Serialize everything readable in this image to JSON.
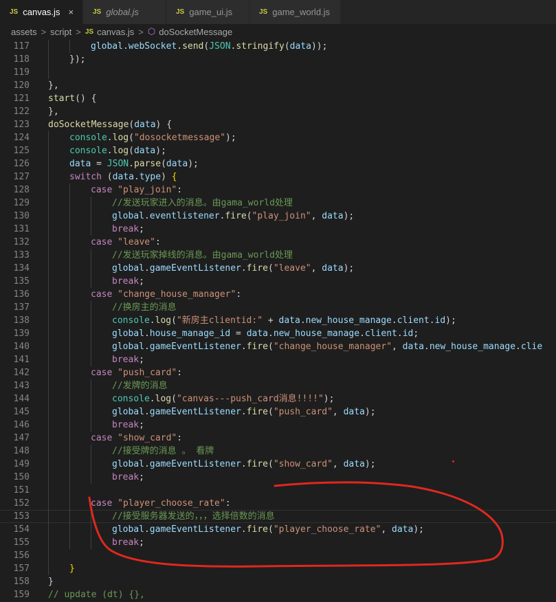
{
  "tabs": [
    {
      "label": "canvas.js",
      "icon": "JS",
      "active": true,
      "italic": false,
      "close": "×"
    },
    {
      "label": "global.js",
      "icon": "JS",
      "active": false,
      "italic": true
    },
    {
      "label": "game_ui.js",
      "icon": "JS",
      "active": false,
      "italic": false
    },
    {
      "label": "game_world.js",
      "icon": "JS",
      "active": false,
      "italic": false
    }
  ],
  "breadcrumb": {
    "items": [
      "assets",
      "script",
      "canvas.js",
      "doSocketMessage"
    ],
    "separator": ">",
    "file_icon": "JS",
    "symbol_icon": "cube-icon"
  },
  "colors": {
    "keyword": "#c586c0",
    "string": "#ce9178",
    "function": "#dcdcaa",
    "variable": "#9cdcfe",
    "class": "#4ec9b0",
    "comment": "#6a9955",
    "annotation": "#e0281e"
  },
  "code": {
    "current_line": 153,
    "lines": [
      {
        "n": "117",
        "indent": 2,
        "tokens": [
          [
            "vr",
            "global"
          ],
          [
            "pl",
            "."
          ],
          [
            "vr",
            "webSocket"
          ],
          [
            "pl",
            "."
          ],
          [
            "fn",
            "send"
          ],
          [
            "pl",
            "("
          ],
          [
            "cl",
            "JSON"
          ],
          [
            "pl",
            "."
          ],
          [
            "fn",
            "stringify"
          ],
          [
            "pl",
            "("
          ],
          [
            "vr",
            "data"
          ],
          [
            "pl",
            "));"
          ]
        ]
      },
      {
        "n": "118",
        "indent": 1,
        "tokens": [
          [
            "pl",
            "});"
          ]
        ]
      },
      {
        "n": "119",
        "indent": 0,
        "tokens": []
      },
      {
        "n": "120",
        "indent": 0,
        "tokens": [
          [
            "pl",
            "},"
          ]
        ]
      },
      {
        "n": "121",
        "indent": 0,
        "tokens": [
          [
            "fn",
            "start"
          ],
          [
            "pl",
            "() {"
          ]
        ]
      },
      {
        "n": "122",
        "indent": 0,
        "tokens": [
          [
            "pl",
            "},"
          ]
        ]
      },
      {
        "n": "123",
        "indent": 0,
        "tokens": [
          [
            "fn",
            "doSocketMessage"
          ],
          [
            "pl",
            "("
          ],
          [
            "vr",
            "data"
          ],
          [
            "pl",
            ") {"
          ]
        ]
      },
      {
        "n": "124",
        "indent": 1,
        "tokens": [
          [
            "cl",
            "console"
          ],
          [
            "pl",
            "."
          ],
          [
            "fn",
            "log"
          ],
          [
            "pl",
            "("
          ],
          [
            "st",
            "\"dosocketmessage\""
          ],
          [
            "pl",
            ");"
          ]
        ]
      },
      {
        "n": "125",
        "indent": 1,
        "tokens": [
          [
            "cl",
            "console"
          ],
          [
            "pl",
            "."
          ],
          [
            "fn",
            "log"
          ],
          [
            "pl",
            "("
          ],
          [
            "vr",
            "data"
          ],
          [
            "pl",
            ");"
          ]
        ]
      },
      {
        "n": "126",
        "indent": 1,
        "tokens": [
          [
            "vr",
            "data"
          ],
          [
            "pl",
            " = "
          ],
          [
            "cl",
            "JSON"
          ],
          [
            "pl",
            "."
          ],
          [
            "fn",
            "parse"
          ],
          [
            "pl",
            "("
          ],
          [
            "vr",
            "data"
          ],
          [
            "pl",
            ");"
          ]
        ]
      },
      {
        "n": "127",
        "indent": 1,
        "tokens": [
          [
            "kw",
            "switch"
          ],
          [
            "pl",
            " ("
          ],
          [
            "vr",
            "data"
          ],
          [
            "pl",
            "."
          ],
          [
            "vr",
            "type"
          ],
          [
            "pl",
            ") "
          ],
          [
            "br",
            "{"
          ]
        ]
      },
      {
        "n": "128",
        "indent": 2,
        "tokens": [
          [
            "kw",
            "case"
          ],
          [
            "pl",
            " "
          ],
          [
            "st",
            "\"play_join\""
          ],
          [
            "pl",
            ":"
          ]
        ]
      },
      {
        "n": "129",
        "indent": 3,
        "tokens": [
          [
            "cm",
            "//发送玩家进入的消息。由gama_world处理"
          ]
        ]
      },
      {
        "n": "130",
        "indent": 3,
        "tokens": [
          [
            "vr",
            "global"
          ],
          [
            "pl",
            "."
          ],
          [
            "vr",
            "eventlistener"
          ],
          [
            "pl",
            "."
          ],
          [
            "fn",
            "fire"
          ],
          [
            "pl",
            "("
          ],
          [
            "st",
            "\"play_join\""
          ],
          [
            "pl",
            ", "
          ],
          [
            "vr",
            "data"
          ],
          [
            "pl",
            ");"
          ]
        ]
      },
      {
        "n": "131",
        "indent": 3,
        "tokens": [
          [
            "kw",
            "break"
          ],
          [
            "pl",
            ";"
          ]
        ]
      },
      {
        "n": "132",
        "indent": 2,
        "tokens": [
          [
            "kw",
            "case"
          ],
          [
            "pl",
            " "
          ],
          [
            "st",
            "\"leave\""
          ],
          [
            "pl",
            ":"
          ]
        ]
      },
      {
        "n": "133",
        "indent": 3,
        "tokens": [
          [
            "cm",
            "//发送玩家掉线的消息。由gama_world处理"
          ]
        ]
      },
      {
        "n": "134",
        "indent": 3,
        "tokens": [
          [
            "vr",
            "global"
          ],
          [
            "pl",
            "."
          ],
          [
            "vr",
            "gameEventListener"
          ],
          [
            "pl",
            "."
          ],
          [
            "fn",
            "fire"
          ],
          [
            "pl",
            "("
          ],
          [
            "st",
            "\"leave\""
          ],
          [
            "pl",
            ", "
          ],
          [
            "vr",
            "data"
          ],
          [
            "pl",
            ");"
          ]
        ]
      },
      {
        "n": "135",
        "indent": 3,
        "tokens": [
          [
            "kw",
            "break"
          ],
          [
            "pl",
            ";"
          ]
        ]
      },
      {
        "n": "136",
        "indent": 2,
        "tokens": [
          [
            "kw",
            "case"
          ],
          [
            "pl",
            " "
          ],
          [
            "st",
            "\"change_house_manager\""
          ],
          [
            "pl",
            ":"
          ]
        ]
      },
      {
        "n": "137",
        "indent": 3,
        "tokens": [
          [
            "cm",
            "//换房主的消息"
          ]
        ]
      },
      {
        "n": "138",
        "indent": 3,
        "tokens": [
          [
            "cl",
            "console"
          ],
          [
            "pl",
            "."
          ],
          [
            "fn",
            "log"
          ],
          [
            "pl",
            "("
          ],
          [
            "st",
            "\"新房主clientid:\""
          ],
          [
            "pl",
            " + "
          ],
          [
            "vr",
            "data"
          ],
          [
            "pl",
            "."
          ],
          [
            "vr",
            "new_house_manage"
          ],
          [
            "pl",
            "."
          ],
          [
            "vr",
            "client"
          ],
          [
            "pl",
            "."
          ],
          [
            "vr",
            "id"
          ],
          [
            "pl",
            ");"
          ]
        ]
      },
      {
        "n": "139",
        "indent": 3,
        "tokens": [
          [
            "vr",
            "global"
          ],
          [
            "pl",
            "."
          ],
          [
            "vr",
            "house_manage_id"
          ],
          [
            "pl",
            " = "
          ],
          [
            "vr",
            "data"
          ],
          [
            "pl",
            "."
          ],
          [
            "vr",
            "new_house_manage"
          ],
          [
            "pl",
            "."
          ],
          [
            "vr",
            "client"
          ],
          [
            "pl",
            "."
          ],
          [
            "vr",
            "id"
          ],
          [
            "pl",
            ";"
          ]
        ]
      },
      {
        "n": "140",
        "indent": 3,
        "tokens": [
          [
            "vr",
            "global"
          ],
          [
            "pl",
            "."
          ],
          [
            "vr",
            "gameEventListener"
          ],
          [
            "pl",
            "."
          ],
          [
            "fn",
            "fire"
          ],
          [
            "pl",
            "("
          ],
          [
            "st",
            "\"change_house_manager\""
          ],
          [
            "pl",
            ", "
          ],
          [
            "vr",
            "data"
          ],
          [
            "pl",
            "."
          ],
          [
            "vr",
            "new_house_manage"
          ],
          [
            "pl",
            "."
          ],
          [
            "vr",
            "clie"
          ]
        ]
      },
      {
        "n": "141",
        "indent": 3,
        "tokens": [
          [
            "kw",
            "break"
          ],
          [
            "pl",
            ";"
          ]
        ]
      },
      {
        "n": "142",
        "indent": 2,
        "tokens": [
          [
            "kw",
            "case"
          ],
          [
            "pl",
            " "
          ],
          [
            "st",
            "\"push_card\""
          ],
          [
            "pl",
            ":"
          ]
        ]
      },
      {
        "n": "143",
        "indent": 3,
        "tokens": [
          [
            "cm",
            "//发牌的消息"
          ]
        ]
      },
      {
        "n": "144",
        "indent": 3,
        "tokens": [
          [
            "cl",
            "console"
          ],
          [
            "pl",
            "."
          ],
          [
            "fn",
            "log"
          ],
          [
            "pl",
            "("
          ],
          [
            "st",
            "\"canvas---push_card消息!!!!\""
          ],
          [
            "pl",
            ");"
          ]
        ]
      },
      {
        "n": "145",
        "indent": 3,
        "tokens": [
          [
            "vr",
            "global"
          ],
          [
            "pl",
            "."
          ],
          [
            "vr",
            "gameEventListener"
          ],
          [
            "pl",
            "."
          ],
          [
            "fn",
            "fire"
          ],
          [
            "pl",
            "("
          ],
          [
            "st",
            "\"push_card\""
          ],
          [
            "pl",
            ", "
          ],
          [
            "vr",
            "data"
          ],
          [
            "pl",
            ");"
          ]
        ]
      },
      {
        "n": "146",
        "indent": 3,
        "tokens": [
          [
            "kw",
            "break"
          ],
          [
            "pl",
            ";"
          ]
        ]
      },
      {
        "n": "147",
        "indent": 2,
        "tokens": [
          [
            "kw",
            "case"
          ],
          [
            "pl",
            " "
          ],
          [
            "st",
            "\"show_card\""
          ],
          [
            "pl",
            ":"
          ]
        ]
      },
      {
        "n": "148",
        "indent": 3,
        "tokens": [
          [
            "cm",
            "//接受牌的消息 。 看牌"
          ]
        ]
      },
      {
        "n": "149",
        "indent": 3,
        "tokens": [
          [
            "vr",
            "global"
          ],
          [
            "pl",
            "."
          ],
          [
            "vr",
            "gameEventListener"
          ],
          [
            "pl",
            "."
          ],
          [
            "fn",
            "fire"
          ],
          [
            "pl",
            "("
          ],
          [
            "st",
            "\"show_card\""
          ],
          [
            "pl",
            ", "
          ],
          [
            "vr",
            "data"
          ],
          [
            "pl",
            ");"
          ]
        ]
      },
      {
        "n": "150",
        "indent": 3,
        "tokens": [
          [
            "kw",
            "break"
          ],
          [
            "pl",
            ";"
          ]
        ]
      },
      {
        "n": "151",
        "indent": 0,
        "tokens": []
      },
      {
        "n": "152",
        "indent": 2,
        "tokens": [
          [
            "kw",
            "case"
          ],
          [
            "pl",
            " "
          ],
          [
            "st",
            "\"player_choose_rate\""
          ],
          [
            "pl",
            ":"
          ]
        ]
      },
      {
        "n": "153",
        "indent": 3,
        "tokens": [
          [
            "cm",
            "//接受服务器发送的，，，选择倍数的消息"
          ]
        ]
      },
      {
        "n": "154",
        "indent": 3,
        "tokens": [
          [
            "vr",
            "global"
          ],
          [
            "pl",
            "."
          ],
          [
            "vr",
            "gameEventListener"
          ],
          [
            "pl",
            "."
          ],
          [
            "fn",
            "fire"
          ],
          [
            "pl",
            "("
          ],
          [
            "st",
            "\"player_choose_rate\""
          ],
          [
            "pl",
            ", "
          ],
          [
            "vr",
            "data"
          ],
          [
            "pl",
            ");"
          ]
        ]
      },
      {
        "n": "155",
        "indent": 3,
        "tokens": [
          [
            "kw",
            "break"
          ],
          [
            "pl",
            ";"
          ]
        ]
      },
      {
        "n": "156",
        "indent": 0,
        "tokens": []
      },
      {
        "n": "157",
        "indent": 1,
        "tokens": [
          [
            "br",
            "}"
          ]
        ]
      },
      {
        "n": "158",
        "indent": 0,
        "tokens": [
          [
            "pl",
            "}"
          ]
        ]
      },
      {
        "n": "159",
        "indent": 0,
        "tokens": [
          [
            "cm",
            "// update (dt) {},"
          ]
        ]
      }
    ]
  }
}
